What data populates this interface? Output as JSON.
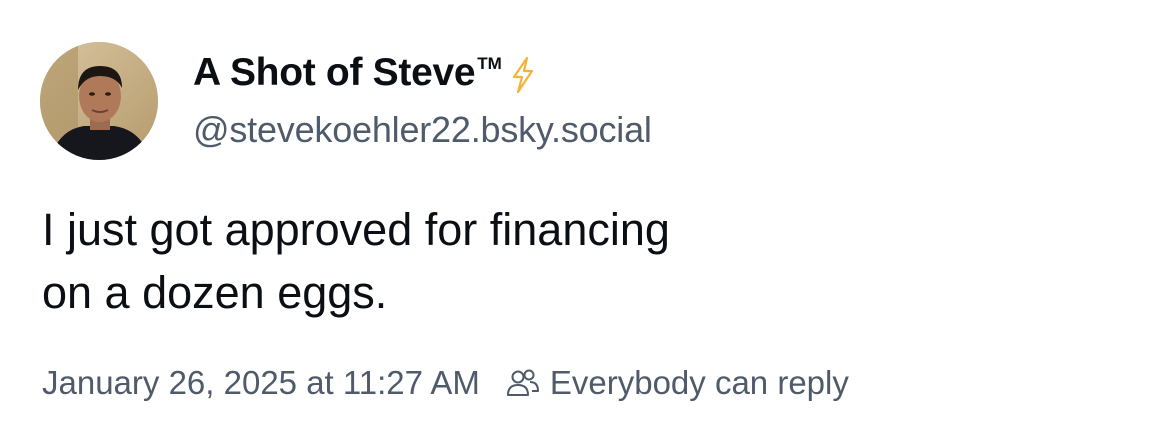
{
  "post": {
    "author": {
      "display_name": "A Shot of Steve",
      "trademark": "TM",
      "badge_icon": "lightning-bolt-icon",
      "badge_color": "#f5b338",
      "handle": "@stevekoehler22.bsky.social"
    },
    "text_lines": [
      "I just got approved for financing",
      "on a dozen eggs."
    ],
    "timestamp": "January 26, 2025 at 11:27 AM",
    "reply_setting": {
      "icon": "people-icon",
      "label": "Everybody can reply"
    }
  },
  "colors": {
    "text_primary": "#0b0f14",
    "text_secondary": "#4f5b6b",
    "background": "#ffffff"
  }
}
